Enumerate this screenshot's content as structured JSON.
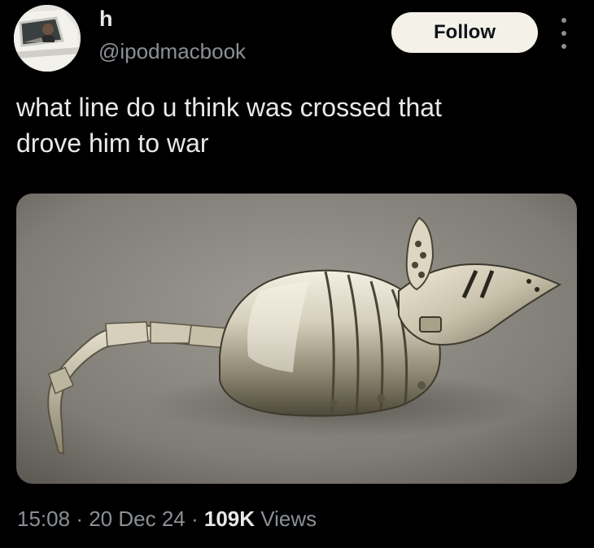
{
  "post": {
    "author": {
      "display_name": "h",
      "handle": "@ipodmacbook",
      "avatar_icon": "avatar-photo-car-window"
    },
    "follow_label": "Follow",
    "more_icon": "more-dots-vertical-icon",
    "text": "what line do u think was crossed that\ndrove him to war",
    "media": {
      "kind": "photo",
      "subject": "armored-mouse-sculpture-icon"
    },
    "meta": {
      "time": "15:08",
      "separator": "·",
      "date": "20 Dec 24",
      "views_count": "109K",
      "views_label": "Views"
    }
  },
  "colors": {
    "background": "#000000",
    "text_primary": "#e7e9ea",
    "text_secondary": "#8b9096",
    "follow_button_bg": "#f4f1e9"
  }
}
